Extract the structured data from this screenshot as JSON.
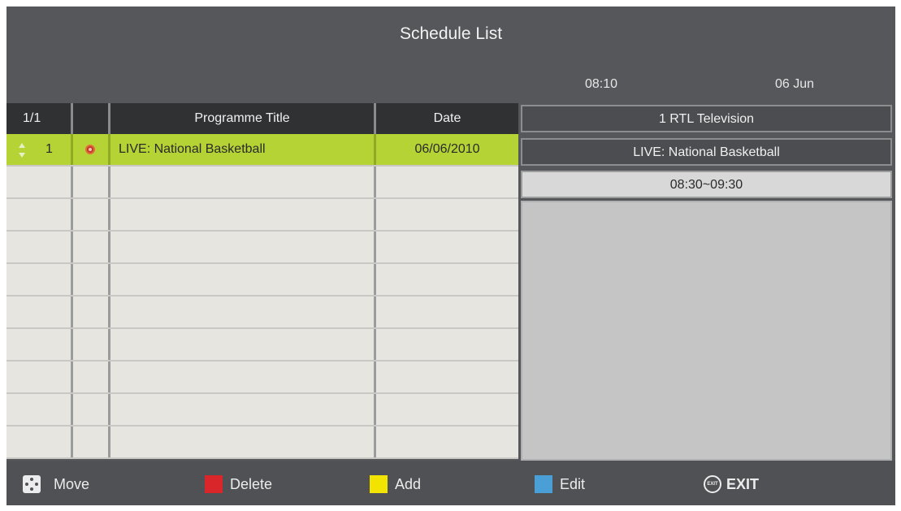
{
  "header": {
    "title": "Schedule List",
    "time": "08:10",
    "date": "06 Jun"
  },
  "table": {
    "page_indicator": "1/1",
    "columns": [
      "Programme Title",
      "Date"
    ],
    "rows": [
      {
        "number": "1",
        "title": "LIVE: National Basketball",
        "date": "06/06/2010",
        "selected": true,
        "status_icon": "record-icon"
      }
    ],
    "empty_rows": 9
  },
  "info_panel": {
    "channel": "1 RTL Television",
    "programme": "LIVE: National Basketball",
    "time_range": "08:30~09:30"
  },
  "footer": {
    "move_label": "Move",
    "delete_label": "Delete",
    "add_label": "Add",
    "edit_label": "Edit",
    "exit_label": "EXIT",
    "colors": {
      "delete": "#d8262a",
      "add": "#f2e400",
      "edit": "#4a9fd6"
    }
  },
  "colors": {
    "selected_row": "#b5d334",
    "background": "#55575a"
  }
}
